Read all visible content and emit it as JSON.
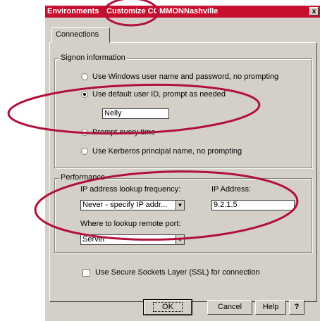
{
  "window": {
    "title_part1": "Environments",
    "title_part2": "Customize COMMONNashville",
    "close_glyph": "x"
  },
  "tabs": [
    {
      "label": "Connections"
    }
  ],
  "signon": {
    "legend": "Signon information",
    "options": [
      {
        "label": "Use Windows user name and password, no prompting",
        "selected": false
      },
      {
        "label": "Use default user ID, prompt as needed",
        "selected": true
      },
      {
        "label": "Prompt every time",
        "selected": false
      },
      {
        "label": "Use Kerberos principal name, no prompting",
        "selected": false
      }
    ],
    "user_id_value": "Nelly"
  },
  "performance": {
    "legend": "Performance",
    "lookup_label": "IP address lookup frequency:",
    "lookup_value": "Never - specify IP addr...",
    "ip_label": "IP Address:",
    "ip_value": "9.2.1.5",
    "port_label": "Where to lookup remote port:",
    "port_value": "Server"
  },
  "ssl": {
    "label": "Use Secure Sockets Layer (SSL) for connection",
    "checked": false
  },
  "buttons": {
    "ok": "OK",
    "cancel": "Cancel",
    "help": "Help",
    "context_help": "?"
  },
  "annotation_color": "#b0103a"
}
